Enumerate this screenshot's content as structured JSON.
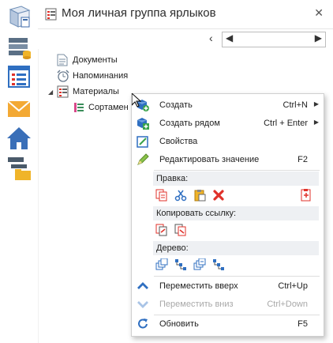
{
  "panel": {
    "title": "Моя личная группа ярлыков",
    "close_glyph": "✕",
    "nav_prev_glyph": "‹",
    "nav_left_glyph": "◀",
    "nav_right_glyph": "▶"
  },
  "rail": {
    "items": [
      {
        "icon": "3d-model-icon"
      },
      {
        "icon": "layers-database-icon"
      },
      {
        "icon": "form-list-icon"
      },
      {
        "icon": "mail-envelope-icon"
      },
      {
        "icon": "home-icon"
      },
      {
        "icon": "folder-tree-icon"
      }
    ]
  },
  "tree": {
    "items": [
      {
        "label": "Документы",
        "icon": "document-icon"
      },
      {
        "label": "Напоминания",
        "icon": "alarm-clock-icon"
      },
      {
        "label": "Материалы",
        "icon": "materials-group-icon",
        "expanded": true
      },
      {
        "label": "Сортамен",
        "icon": "assortment-icon"
      }
    ]
  },
  "menu": {
    "create": {
      "label": "Создать",
      "shortcut": "Ctrl+N"
    },
    "create_near": {
      "label": "Создать рядом",
      "shortcut": "Ctrl + Enter"
    },
    "properties": {
      "label": "Свойства"
    },
    "edit_value": {
      "label": "Редактировать значение",
      "shortcut": "F2"
    },
    "edit_group": "Правка:",
    "copy_link_group": "Копировать ссылку:",
    "tree_group": "Дерево:",
    "move_up": {
      "label": "Переместить вверх",
      "shortcut": "Ctrl+Up"
    },
    "move_down": {
      "label": "Переместить вниз",
      "shortcut": "Ctrl+Down",
      "enabled": false
    },
    "refresh": {
      "label": "Обновить",
      "shortcut": "F5"
    }
  },
  "colors": {
    "accent": "#2f6fc1",
    "delete_red": "#e0312a",
    "header_bg": "#eef0f3"
  }
}
